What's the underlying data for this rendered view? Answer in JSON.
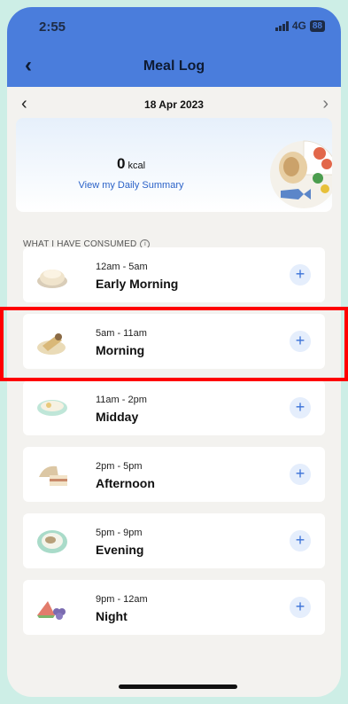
{
  "status_bar": {
    "time": "2:55",
    "network": "4G",
    "battery": "88"
  },
  "header": {
    "title": "Meal Log",
    "back_icon": "chevron-left-icon"
  },
  "date_nav": {
    "date": "18 Apr 2023",
    "prev_icon": "chevron-left-icon",
    "next_icon": "chevron-right-icon"
  },
  "summary": {
    "kcal_value": "0",
    "kcal_unit": "kcal",
    "link_label": "View my Daily Summary"
  },
  "section": {
    "label": "WHAT I HAVE CONSUMED",
    "info_icon": "info-icon"
  },
  "meals": [
    {
      "range": "12am - 5am",
      "name": "Early Morning",
      "icon": "dumpling-icon"
    },
    {
      "range": "5am - 11am",
      "name": "Morning",
      "icon": "breakfast-icon"
    },
    {
      "range": "11am - 2pm",
      "name": "Midday",
      "icon": "bowl-icon"
    },
    {
      "range": "2pm - 5pm",
      "name": "Afternoon",
      "icon": "cake-icon"
    },
    {
      "range": "5pm - 9pm",
      "name": "Evening",
      "icon": "plate-icon"
    },
    {
      "range": "9pm - 12am",
      "name": "Night",
      "icon": "fruit-icon"
    }
  ],
  "add_glyph": "+",
  "colors": {
    "header": "#4a7ddc",
    "accent": "#3b72d8",
    "highlight": "#ff0000"
  }
}
